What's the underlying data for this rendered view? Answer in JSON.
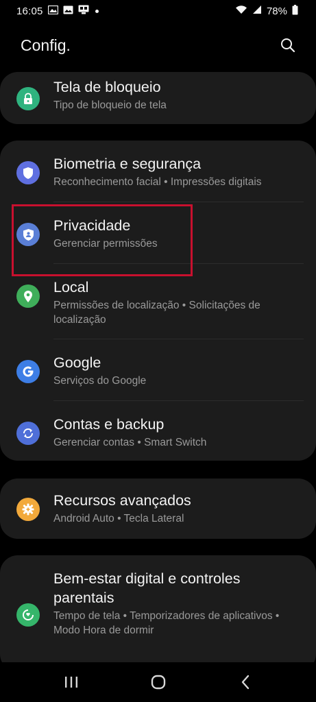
{
  "status_bar": {
    "time": "16:05",
    "battery_percent": "78%",
    "icons_left": [
      "photo-icon",
      "gallery-icon",
      "cast-icon",
      "notification-dot"
    ],
    "icons_right": [
      "wifi-icon",
      "signal-icon",
      "battery-icon"
    ]
  },
  "header": {
    "title": "Config.",
    "search_icon": "search-icon"
  },
  "groups": [
    {
      "items": [
        {
          "title": "Tela de bloqueio",
          "subtitle": "Tipo de bloqueio de tela",
          "icon": "lock-icon",
          "icon_color": "#2fb37f"
        }
      ]
    },
    {
      "items": [
        {
          "title": "Biometria e segurança",
          "subtitle": "Reconhecimento facial  •  Impressões digitais",
          "icon": "shield-icon",
          "icon_color": "#5f6fe0"
        },
        {
          "title": "Privacidade",
          "subtitle": "Gerenciar permissões",
          "icon": "privacy-shield-icon",
          "icon_color": "#5a7fd6"
        },
        {
          "title": "Local",
          "subtitle": "Permissões de localização  •  Solicitações de localização",
          "icon": "location-pin-icon",
          "icon_color": "#3fae5a"
        },
        {
          "title": "Google",
          "subtitle": "Serviços do Google",
          "icon": "google-icon",
          "icon_color": "#3d7ee6"
        },
        {
          "title": "Contas e backup",
          "subtitle": "Gerenciar contas  •  Smart Switch",
          "icon": "sync-icon",
          "icon_color": "#4f6fd8"
        }
      ]
    },
    {
      "items": [
        {
          "title": "Recursos avançados",
          "subtitle": "Android Auto  •  Tecla Lateral",
          "icon": "gear-plus-icon",
          "icon_color": "#f2a93b"
        }
      ]
    },
    {
      "items": [
        {
          "title": "Bem-estar digital e controles parentais",
          "subtitle": "Tempo de tela  •  Temporizadores de aplicativos  •  Modo Hora de dormir",
          "icon": "wellbeing-icon",
          "icon_color": "#35b56a"
        }
      ]
    }
  ],
  "highlight": {
    "target": "Privacidade",
    "color": "#c8102e"
  },
  "nav_bar": {
    "buttons": [
      "recent-apps-icon",
      "home-icon",
      "back-icon"
    ]
  },
  "colors": {
    "background": "#000000",
    "card": "#1c1c1c",
    "title_text": "#f3f3f3",
    "subtitle_text": "#9a9a9a"
  }
}
